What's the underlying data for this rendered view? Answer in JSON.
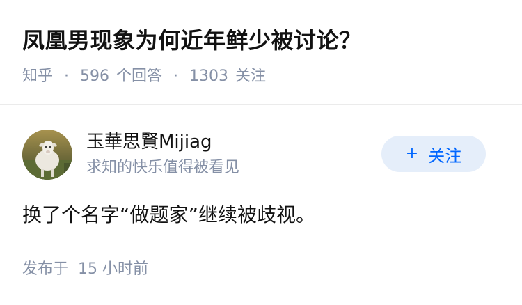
{
  "question": {
    "title": "凤凰男现象为何近年鲜少被讨论？",
    "source": "知乎",
    "separator": "·",
    "answer_count": "596",
    "answer_label": "个回答",
    "follower_count": "1303",
    "follower_label": "关注"
  },
  "answer": {
    "author": {
      "name": "玉華思賢Mijiag",
      "bio": "求知的快乐值得被看见",
      "avatar_icon": "sheep-avatar"
    },
    "follow_button": {
      "icon": "+",
      "label": "关注"
    },
    "content": "换了个名字“做题家”继续被歧视。",
    "published_label": "发布于",
    "published_time": "15 小时前"
  },
  "colors": {
    "text_primary": "#121212",
    "text_secondary": "#8590a6",
    "accent": "#0066ff",
    "button_bg": "#e5eefa",
    "divider": "#ebebeb"
  }
}
